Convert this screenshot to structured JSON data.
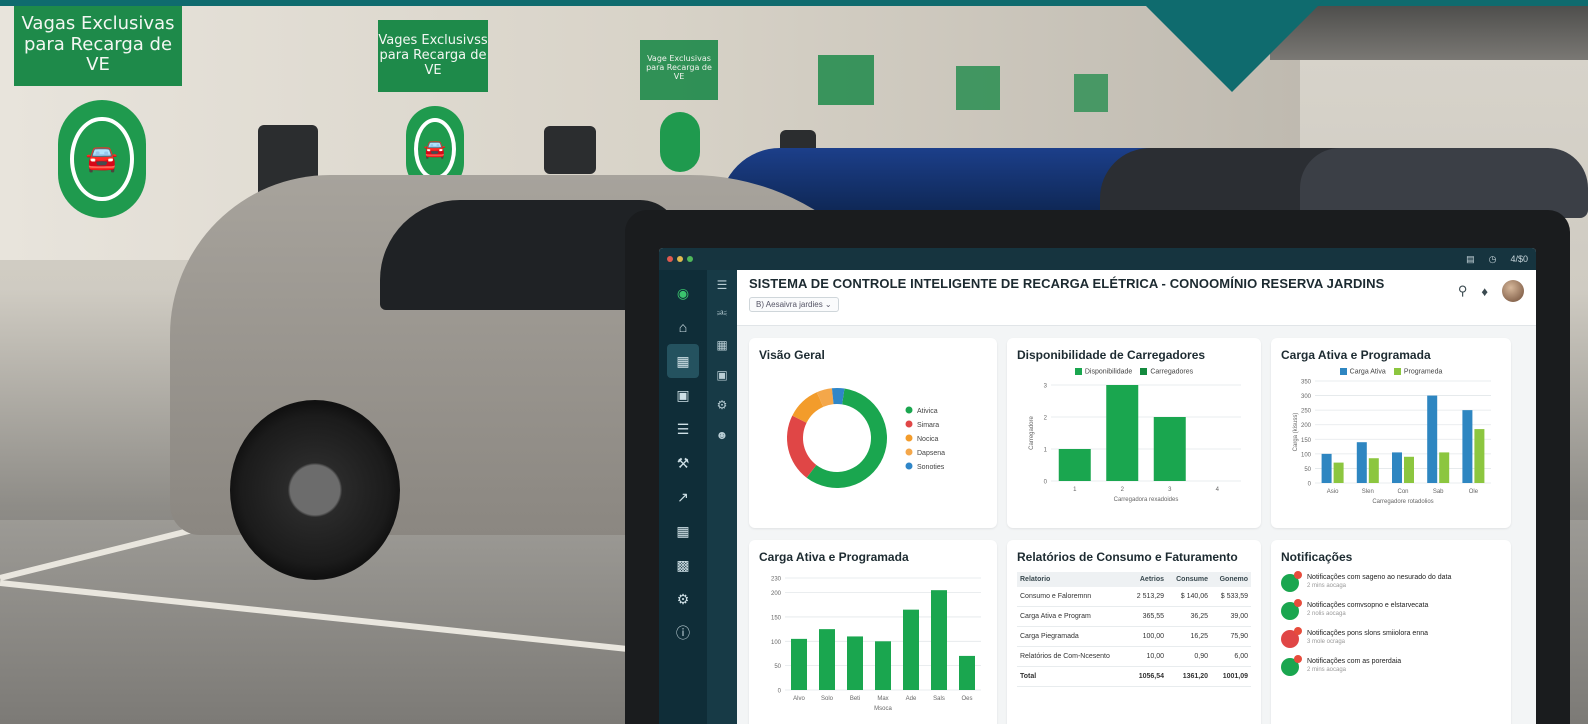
{
  "signs": [
    "Vagas Exclusivas para Recarga de VE",
    "Vages Exclusivss para Recarga de VE",
    "Vage Exclusivas para Recarga de VE"
  ],
  "window": {
    "right_label": "4/$0"
  },
  "app": {
    "title": "SISTEMA DE CONTROLE INTELIGENTE DE RECARGA ELÉTRICA - CONOOMÍNIO RESERVA JARDINS",
    "selector": "B) Aesaivra jardies",
    "rail_icons": [
      "car-logo-icon",
      "home-icon",
      "dashboard-icon",
      "car-icon",
      "list-icon",
      "wrench-icon",
      "chart-icon",
      "calendar-icon",
      "org-icon",
      "gear-icon",
      "info-icon"
    ],
    "rail2_icons": [
      "plug-icon",
      "calendar-icon",
      "box-icon",
      "gear-icon",
      "user-icon"
    ]
  },
  "cards": {
    "overview": {
      "title": "Visão Geral"
    },
    "availability": {
      "title": "Disponibilidade de Carregadores",
      "legend": [
        "Disponibilidade",
        "Carregadores"
      ],
      "ylabel": "Carregadore",
      "xlabel": "Carregadora rexadoides"
    },
    "active1": {
      "title": "Carga Ativa e Programada",
      "legend": [
        "Carga Ativa",
        "Programada"
      ],
      "ylabel": "Carga (kisuss)",
      "xlabel": "Carregadore rotadolios"
    },
    "active2": {
      "title": "Carga Ativa e Programada",
      "xlabel": "Msoca"
    },
    "reports": {
      "title": "Relatórios de Consumo e Faturamento"
    },
    "notifications": {
      "title": "Notificações"
    }
  },
  "chart_data": [
    {
      "type": "pie",
      "title": "Visão Geral",
      "categories": [
        "Ativica",
        "Simara",
        "Nocica",
        "Dapsena",
        "Sonoties"
      ],
      "values": [
        58,
        22,
        11,
        5,
        4
      ],
      "colors": [
        "#1aa64f",
        "#e04646",
        "#f39c2b",
        "#f4a74a",
        "#2f86c8"
      ]
    },
    {
      "type": "bar",
      "title": "Disponibilidade de Carregadores",
      "categories": [
        "1",
        "2",
        "3",
        "4"
      ],
      "values": [
        1,
        3,
        2,
        0
      ],
      "ylim": [
        0,
        3
      ],
      "yticks": [
        "0",
        "1",
        "2",
        "3"
      ],
      "color": "#1aa64f"
    },
    {
      "type": "bar",
      "title": "Carga Ativa e Programada",
      "categories": [
        "Asio",
        "Slen",
        "Con",
        "Sab",
        "Ole"
      ],
      "series": [
        {
          "name": "Carga Ativa",
          "values": [
            100,
            140,
            105,
            300,
            250
          ],
          "color": "#2e86c1"
        },
        {
          "name": "Programeda",
          "values": [
            70,
            85,
            90,
            105,
            185
          ],
          "color": "#8cc63f"
        }
      ],
      "ylim": [
        0,
        350
      ],
      "yticks": [
        "0",
        "50",
        "100",
        "150",
        "200",
        "250",
        "300",
        "350"
      ]
    },
    {
      "type": "bar",
      "title": "Carga Ativa e Programada",
      "categories": [
        "Alvo",
        "Solo",
        "Beti",
        "Max",
        "Ade",
        "Sals",
        "Oes"
      ],
      "values": [
        105,
        125,
        110,
        100,
        165,
        205,
        70
      ],
      "ylim": [
        0,
        230
      ],
      "yticks": [
        "0",
        "50",
        "100",
        "150",
        "200",
        "230"
      ],
      "color": "#1aa64f"
    }
  ],
  "reports_table": {
    "headers": [
      "Relatorio",
      "Aetrios",
      "Consume",
      "Gonemo"
    ],
    "rows": [
      [
        "Consumo e Faloremnn",
        "2 513,29",
        "$ 140,06",
        "$ 533,59"
      ],
      [
        "Carga Ativa e Program",
        "365,55",
        "36,25",
        "39,00"
      ],
      [
        "Carga Piegramada",
        "100,00",
        "16,25",
        "75,90"
      ],
      [
        "Relatórios de Com-Ncesento",
        "10,00",
        "0,90",
        "6,00"
      ],
      [
        "Total",
        "1056,54",
        "1361,20",
        "1001,09"
      ]
    ]
  },
  "notifications": [
    {
      "text": "Notificações com sageno ao nesurado do data",
      "time": "2 mins aocaga",
      "color": "#1aa64f"
    },
    {
      "text": "Notificações comvsopno e elstarvecata",
      "time": "2 nolis aocaga",
      "color": "#1aa64f"
    },
    {
      "text": "Notificações pons slons smiiolora enna",
      "time": "3 mole ocraga",
      "color": "#e04646"
    },
    {
      "text": "Notificações com as porerdaia",
      "time": "2 mins aocaga",
      "color": "#1aa64f"
    }
  ]
}
